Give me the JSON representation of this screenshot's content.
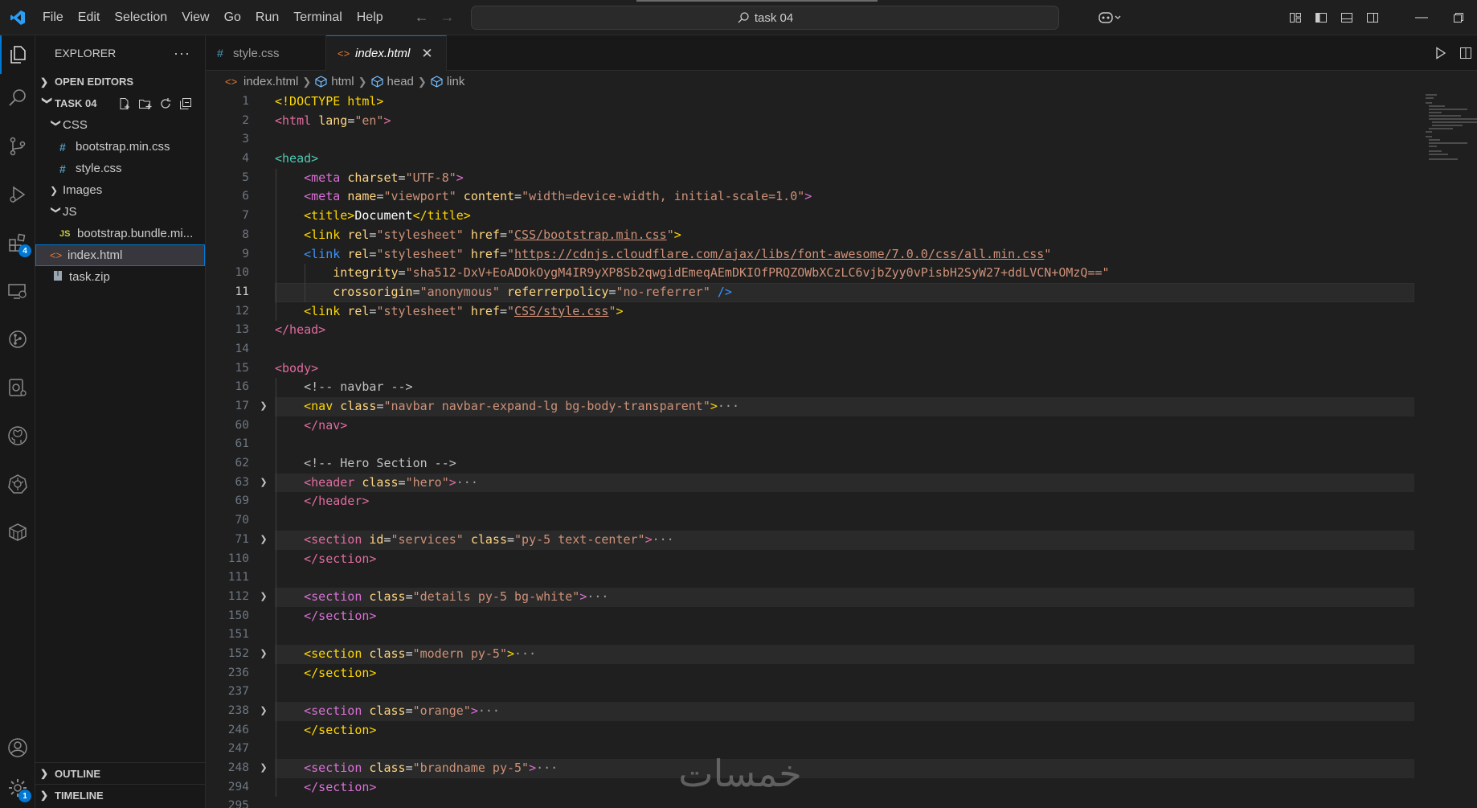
{
  "titlebar": {
    "menu": [
      "File",
      "Edit",
      "Selection",
      "View",
      "Go",
      "Run",
      "Terminal",
      "Help"
    ],
    "search_text": "task 04"
  },
  "activity_badges": {
    "extensions": "4",
    "manage": "1"
  },
  "sidebar": {
    "title": "EXPLORER",
    "open_editors": "OPEN EDITORS",
    "project": "TASK 04",
    "tree": [
      {
        "label": "CSS",
        "kind": "folder-open"
      },
      {
        "label": "bootstrap.min.css",
        "kind": "css"
      },
      {
        "label": "style.css",
        "kind": "css"
      },
      {
        "label": "Images",
        "kind": "folder"
      },
      {
        "label": "JS",
        "kind": "folder-open"
      },
      {
        "label": "bootstrap.bundle.mi...",
        "kind": "js"
      },
      {
        "label": "index.html",
        "kind": "html"
      },
      {
        "label": "task.zip",
        "kind": "zip"
      }
    ],
    "outline": "OUTLINE",
    "timeline": "TIMELINE"
  },
  "tabs": [
    {
      "label": "style.css",
      "icon": "#"
    },
    {
      "label": "index.html",
      "icon": "<>"
    }
  ],
  "breadcrumbs": [
    "index.html",
    "html",
    "head",
    "link"
  ],
  "line_numbers": [
    "1",
    "2",
    "3",
    "4",
    "5",
    "6",
    "7",
    "8",
    "9",
    "10",
    "11",
    "12",
    "13",
    "14",
    "15",
    "16",
    "17",
    "60",
    "61",
    "62",
    "63",
    "69",
    "70",
    "71",
    "110",
    "111",
    "112",
    "150",
    "151",
    "152",
    "236",
    "237",
    "238",
    "246",
    "247",
    "248",
    "294",
    "295"
  ],
  "code": {
    "l1": "<!DOCTYPE html>",
    "l2a": "<html ",
    "l2b": "lang",
    "l2c": "=",
    "l2d": "\"en\"",
    "l2e": ">",
    "l4": "<head>",
    "l5a": "<meta ",
    "l5b": "charset",
    "l5c": "=",
    "l5d": "\"UTF-8\"",
    "l5e": ">",
    "l6a": "<meta ",
    "l6b": "name",
    "l6c": "=",
    "l6d": "\"viewport\"",
    "l6e": " content",
    "l6f": "=",
    "l6g": "\"width=device-width, initial-scale=1.0\"",
    "l6h": ">",
    "l7a": "<title>",
    "l7b": "Document",
    "l7c": "</title>",
    "l8a": "<link ",
    "l8b": "rel",
    "l8c": "=",
    "l8d": "\"stylesheet\"",
    "l8e": " href",
    "l8f": "=",
    "l8g": "\"",
    "l8h": "CSS/bootstrap.min.css",
    "l8i": "\"",
    "l8j": ">",
    "l9a": "<link ",
    "l9b": "rel",
    "l9c": "=",
    "l9d": "\"stylesheet\"",
    "l9e": " href",
    "l9f": "=",
    "l9g": "\"",
    "l9h": "https://cdnjs.cloudflare.com/ajax/libs/font-awesome/7.0.0/css/all.min.css",
    "l9i": "\"",
    "l10a": "integrity",
    "l10b": "=",
    "l10c": "\"sha512-DxV+EoADOkOygM4IR9yXP8Sb2qwgidEmeqAEmDKIOfPRQZOWbXCzLC6vjbZyy0vPisbH2SyW27+ddLVCN+OMzQ==\"",
    "l11a": "crossorigin",
    "l11b": "=",
    "l11c": "\"anonymous\"",
    "l11d": " referrerpolicy",
    "l11e": "=",
    "l11f": "\"no-referrer\"",
    "l11g": " />",
    "l12a": "<link ",
    "l12b": "rel",
    "l12c": "=",
    "l12d": "\"stylesheet\"",
    "l12e": " href",
    "l12f": "=",
    "l12g": "\"",
    "l12h": "CSS/style.css",
    "l12i": "\"",
    "l12j": ">",
    "l13": "</head>",
    "l15": "<body>",
    "l16": "<!-- navbar -->",
    "l17a": "<nav ",
    "l17b": "class",
    "l17c": "=",
    "l17d": "\"navbar navbar-expand-lg bg-body-transparent\"",
    "l17e": ">",
    "l17f": "···",
    "l60": "</nav>",
    "l62": "<!-- Hero Section -->",
    "l63a": "<header ",
    "l63b": "class",
    "l63c": "=",
    "l63d": "\"hero\"",
    "l63e": ">",
    "l63f": "···",
    "l69": "</header>",
    "l71a": "<section ",
    "l71b": "id",
    "l71c": "=",
    "l71d": "\"services\"",
    "l71e": " class",
    "l71f": "=",
    "l71g": "\"py-5 text-center\"",
    "l71h": ">",
    "l71i": "···",
    "l110": "</section>",
    "l112a": "<section ",
    "l112b": "class",
    "l112c": "=",
    "l112d": "\"details py-5 bg-white\"",
    "l112e": ">",
    "l112f": "···",
    "l150": "</section>",
    "l152a": "<section ",
    "l152b": "class",
    "l152c": "=",
    "l152d": "\"modern py-5\"",
    "l152e": ">",
    "l152f": "···",
    "l236": "</section>",
    "l238a": "<section ",
    "l238b": "class",
    "l238c": "=",
    "l238d": "\"orange\"",
    "l238e": ">",
    "l238f": "···",
    "l246": "</section>",
    "l248a": "<section ",
    "l248b": "class",
    "l248c": "=",
    "l248d": "\"brandname py-5\"",
    "l248e": ">",
    "l248f": "···",
    "l294": "</section>"
  },
  "watermark": "خمسات"
}
